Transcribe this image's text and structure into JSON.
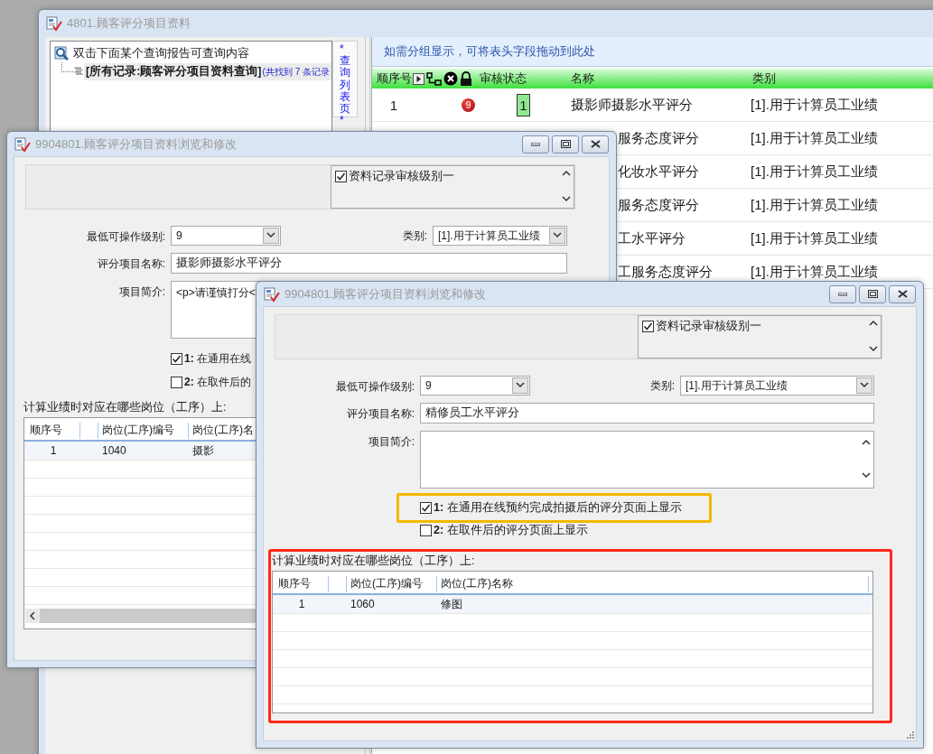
{
  "main_window": {
    "title": "4801.顾客评分项目资料",
    "query_panel": {
      "header": "双击下面某个查询报告可查询内容",
      "items": [
        {
          "label": "[所有记录:顾客评分项目资料查询]",
          "count": "(共找到 7 条记录",
          "selected": true
        }
      ]
    },
    "side_tab": {
      "lead": "*",
      "label": "查询列表页",
      "trail": "*"
    },
    "group_hint": "如需分组显示，可将表头字段拖动到此处",
    "table": {
      "columns": [
        "顺序号",
        "审核状态",
        "名称",
        "类别"
      ],
      "rows": [
        {
          "seq": "1",
          "badge": "9",
          "status": "1",
          "name": "摄影师摄影水平评分",
          "category": "[1].用于计算员工业绩"
        },
        {
          "name": "服务态度评分",
          "category": "[1].用于计算员工业绩"
        },
        {
          "name": "化妆水平评分",
          "category": "[1].用于计算员工业绩"
        },
        {
          "name": "服务态度评分",
          "category": "[1].用于计算员工业绩"
        },
        {
          "name": "工水平评分",
          "category": "[1].用于计算员工业绩"
        },
        {
          "name": "工服务态度评分",
          "category": "[1].用于计算员工业绩"
        }
      ]
    }
  },
  "windows": [
    {
      "title": "9904801.顾客评分项目资料浏览和修改",
      "audit_options": [
        {
          "label": "资料记录审核级别一",
          "checked": true
        }
      ],
      "min_level": {
        "label": "最低可操作级别:",
        "value": "9"
      },
      "category": {
        "label": "类别:",
        "value": "[1].用于计算员工业绩"
      },
      "item_name": {
        "label": "评分项目名称:",
        "value": "摄影师摄影水平评分"
      },
      "summary": {
        "label": "项目简介:",
        "value": "<p>请谨慎打分<"
      },
      "options": [
        {
          "label": "**1:** 在通用在线",
          "checked": true,
          "highlighted": false
        },
        {
          "label": "**2:** 在取件后的",
          "checked": false,
          "highlighted": false
        }
      ],
      "positions": {
        "label": "计算业绩时对应在哪些岗位（工序）上:",
        "highlighted": false,
        "scrollbar": true,
        "columns": [
          "顺序号",
          "岗位(工序)编号",
          "岗位(工序)名"
        ],
        "rows": [
          {
            "seq": "1",
            "code": "1040",
            "name": "摄影",
            "selected": true
          }
        ]
      }
    },
    {
      "title": "9904801.顾客评分项目资料浏览和修改",
      "audit_options": [
        {
          "label": "资料记录审核级别一",
          "checked": true
        }
      ],
      "min_level": {
        "label": "最低可操作级别:",
        "value": "9"
      },
      "category": {
        "label": "类别:",
        "value": "[1].用于计算员工业绩"
      },
      "item_name": {
        "label": "评分项目名称:",
        "value": "精修员工水平评分"
      },
      "summary": {
        "label": "项目简介:",
        "scrollable": true
      },
      "options": [
        {
          "label": "**1:** 在通用在线预约完成拍摄后的评分页面上显示",
          "checked": true,
          "highlighted": true
        },
        {
          "label": "**2:** 在取件后的评分页面上显示",
          "checked": false,
          "highlighted": false
        }
      ],
      "positions": {
        "label": "计算业绩时对应在哪些岗位（工序）上:",
        "highlighted": true,
        "scrollbar": false,
        "columns": [
          "顺序号",
          "岗位(工序)编号",
          "岗位(工序)名称"
        ],
        "rows": [
          {
            "seq": "1",
            "code": "1060",
            "name": "修图",
            "selected": true
          }
        ]
      }
    }
  ]
}
